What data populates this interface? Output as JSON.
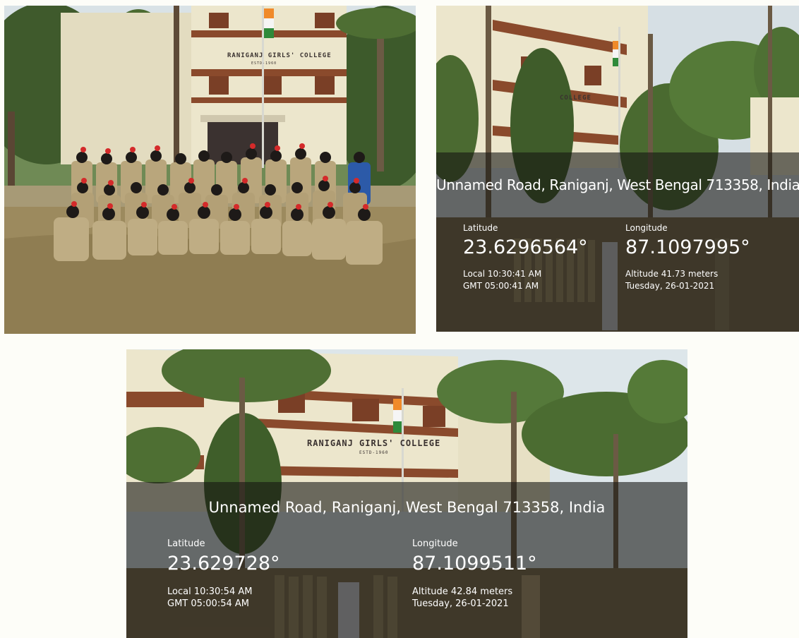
{
  "photos": [
    {
      "id": "group-photo",
      "building_sign": "RANIGANJ GIRLS' COLLEGE",
      "building_sign_sub": "ESTD-1960"
    },
    {
      "id": "gps-photo-1",
      "building_sign": "COLLEGE",
      "address": "Unnamed Road, Raniganj, West Bengal 713358, India",
      "latitude_label": "Latitude",
      "latitude_value": "23.6296564°",
      "longitude_label": "Longitude",
      "longitude_value": "87.1097995°",
      "local_time": "Local 10:30:41 AM",
      "gmt_time": "GMT 05:00:41 AM",
      "altitude": "Altitude 41.73 meters",
      "date": "Tuesday, 26-01-2021"
    },
    {
      "id": "gps-photo-2",
      "building_sign": "RANIGANJ GIRLS' COLLEGE",
      "building_sign_sub": "ESTD-1960",
      "address": "Unnamed Road, Raniganj, West Bengal 713358, India",
      "latitude_label": "Latitude",
      "latitude_value": "23.629728°",
      "longitude_label": "Longitude",
      "longitude_value": "87.1099511°",
      "local_time": "Local 10:30:54 AM",
      "gmt_time": "GMT 05:00:54 AM",
      "altitude": "Altitude 42.84 meters",
      "date": "Tuesday, 26-01-2021"
    }
  ],
  "colors": {
    "background": "#fdfdf8",
    "building_wall": "#ece6cc",
    "building_trim": "#8a4a2c",
    "ground_grass": "#9c8a5e",
    "uniform_khaki": "#b9a67c",
    "beret_black": "#1e1a18",
    "plume_red": "#d42a2a",
    "overlay": "rgba(22,22,18,0.60)"
  }
}
